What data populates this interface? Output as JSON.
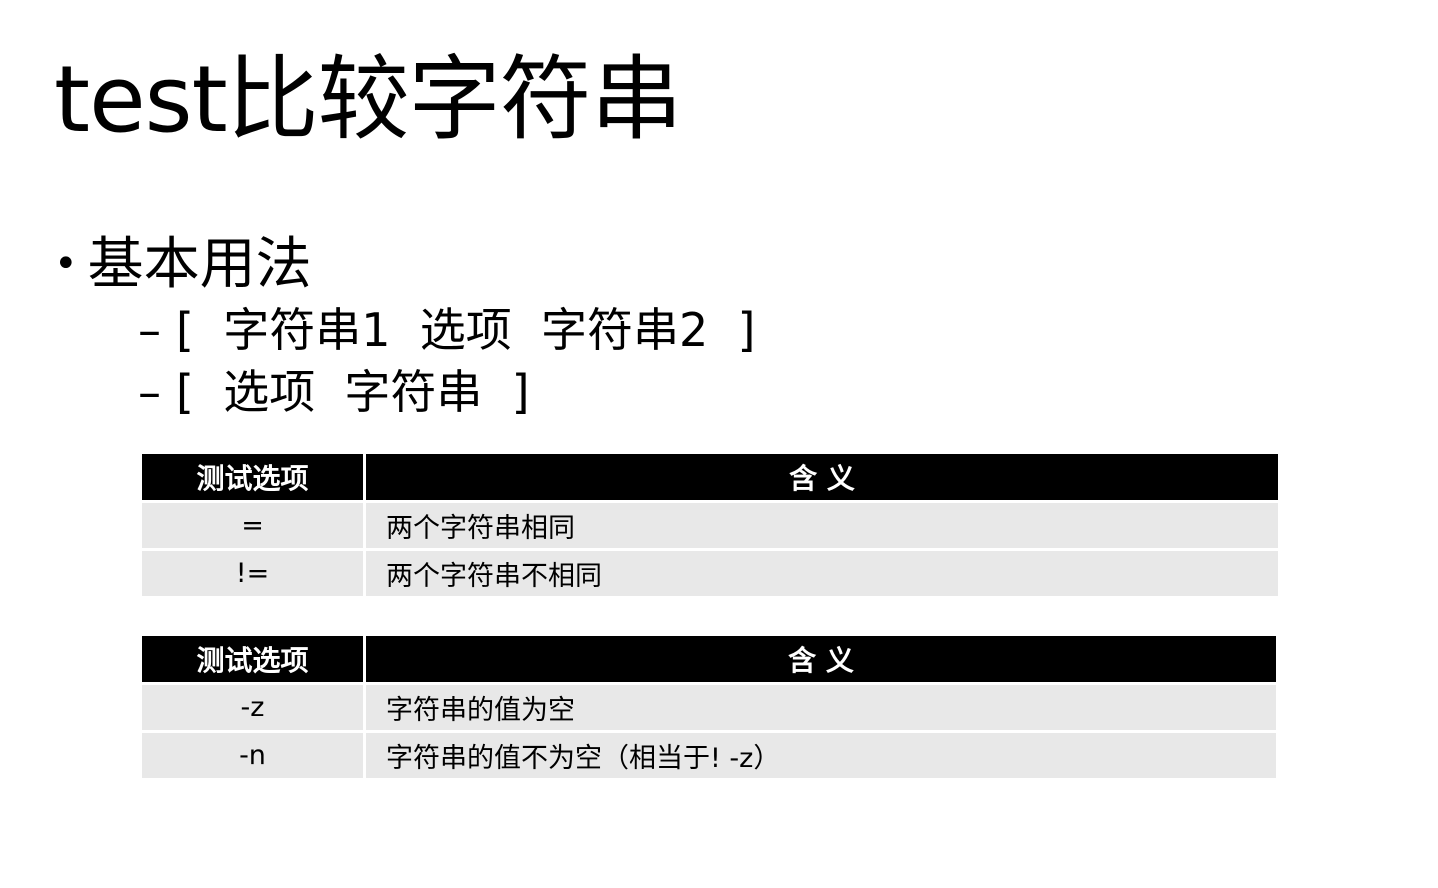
{
  "title": "test比较字符串",
  "bullet": {
    "symbol": "•",
    "text": "基本用法"
  },
  "sub_bullets": [
    {
      "dash": "–",
      "text": "[  字符串1  选项  字符串2  ]"
    },
    {
      "dash": "–",
      "text": "[  选项  字符串  ]"
    }
  ],
  "tables": [
    {
      "headers": [
        "测试选项",
        "含 义"
      ],
      "rows": [
        {
          "option": "=",
          "meaning": "两个字符串相同"
        },
        {
          "option": "!=",
          "meaning": "两个字符串不相同"
        }
      ]
    },
    {
      "headers": [
        "测试选项",
        "含 义"
      ],
      "rows": [
        {
          "option": "-z",
          "meaning": "字符串的值为空"
        },
        {
          "option": "-n",
          "meaning": "字符串的值不为空（相当于! -z）"
        }
      ]
    }
  ]
}
